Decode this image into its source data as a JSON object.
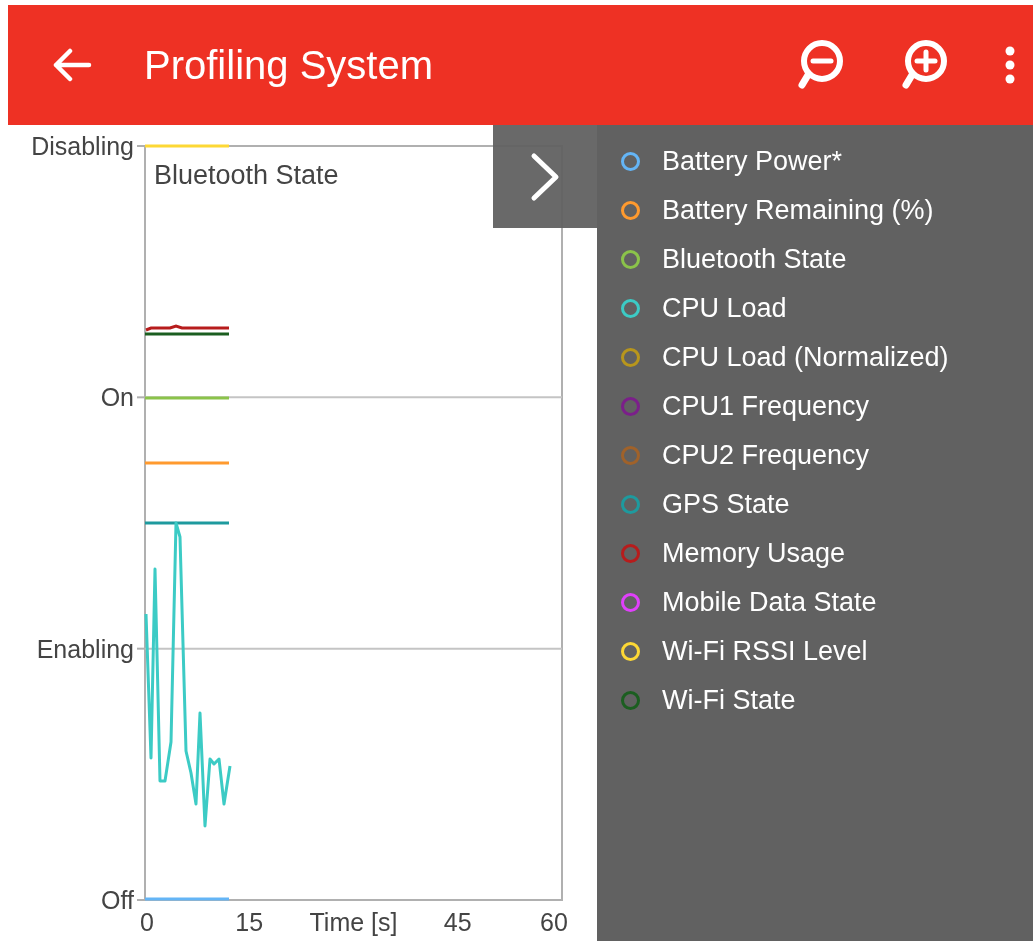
{
  "app_bar": {
    "title": "Profiling System"
  },
  "chart": {
    "title": "Bluetooth State",
    "y_axis_labels": [
      "Disabling",
      "On",
      "Enabling",
      "Off"
    ],
    "x_axis_labels": [
      "0",
      "15",
      "45",
      "60"
    ],
    "x_axis_title": "Time [s]"
  },
  "legend": {
    "items": [
      {
        "label": "Battery Power*",
        "color": "#64b5f6"
      },
      {
        "label": "Battery Remaining (%)",
        "color": "#ff9a2e"
      },
      {
        "label": "Bluetooth State",
        "color": "#8bc34a"
      },
      {
        "label": "CPU Load",
        "color": "#3ccbc5"
      },
      {
        "label": "CPU Load (Normalized)",
        "color": "#b8961c"
      },
      {
        "label": "CPU1 Frequency",
        "color": "#7b1f8a"
      },
      {
        "label": "CPU2 Frequency",
        "color": "#a0622a"
      },
      {
        "label": "GPS State",
        "color": "#1e9a9e"
      },
      {
        "label": "Memory Usage",
        "color": "#b71c1c"
      },
      {
        "label": "Mobile Data State",
        "color": "#e040fb"
      },
      {
        "label": "Wi-Fi RSSI Level",
        "color": "#fdd835"
      },
      {
        "label": "Wi-Fi State",
        "color": "#1b5e20"
      }
    ]
  }
}
